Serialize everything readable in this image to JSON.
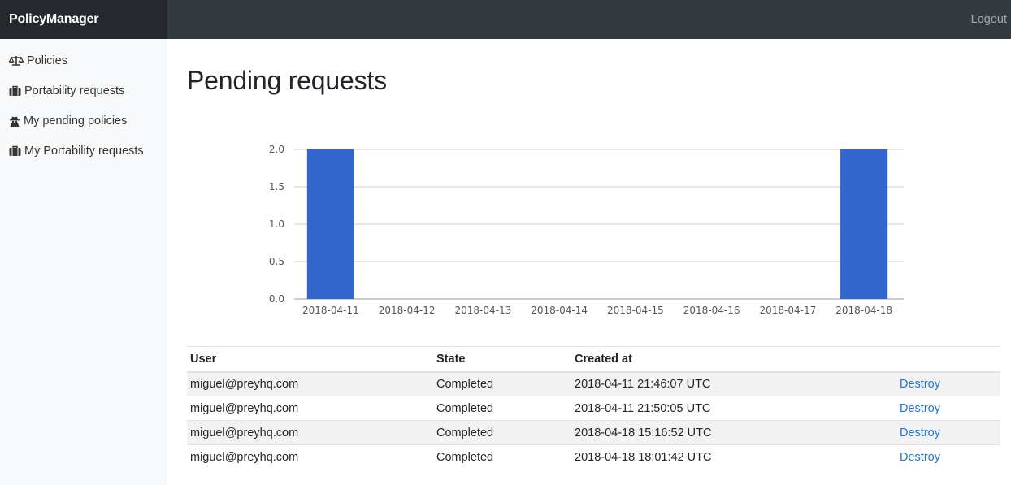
{
  "app": {
    "brand": "PolicyManager",
    "logout": "Logout"
  },
  "sidebar": {
    "items": [
      {
        "label": "Policies",
        "icon": "balance-scale-icon"
      },
      {
        "label": "Portability requests",
        "icon": "briefcase-icon"
      },
      {
        "label": "My pending policies",
        "icon": "user-secret-icon"
      },
      {
        "label": "My Portability requests",
        "icon": "briefcase-icon"
      }
    ]
  },
  "page": {
    "title": "Pending requests"
  },
  "chart_data": {
    "type": "bar",
    "categories": [
      "2018-04-11",
      "2018-04-12",
      "2018-04-13",
      "2018-04-14",
      "2018-04-15",
      "2018-04-16",
      "2018-04-17",
      "2018-04-18"
    ],
    "values": [
      2,
      0,
      0,
      0,
      0,
      0,
      0,
      2
    ],
    "ylim": [
      0,
      2
    ],
    "yticks": [
      "0.0",
      "0.5",
      "1.0",
      "1.5",
      "2.0"
    ],
    "grid": true,
    "bar_color": "#3366cc"
  },
  "table": {
    "headers": {
      "user": "User",
      "state": "State",
      "created": "Created at"
    },
    "rows": [
      {
        "user": "miguel@preyhq.com",
        "state": "Completed",
        "created": "2018-04-11 21:46:07 UTC",
        "action": "Destroy"
      },
      {
        "user": "miguel@preyhq.com",
        "state": "Completed",
        "created": "2018-04-11 21:50:05 UTC",
        "action": "Destroy"
      },
      {
        "user": "miguel@preyhq.com",
        "state": "Completed",
        "created": "2018-04-18 15:16:52 UTC",
        "action": "Destroy"
      },
      {
        "user": "miguel@preyhq.com",
        "state": "Completed",
        "created": "2018-04-18 18:01:42 UTC",
        "action": "Destroy"
      }
    ]
  }
}
